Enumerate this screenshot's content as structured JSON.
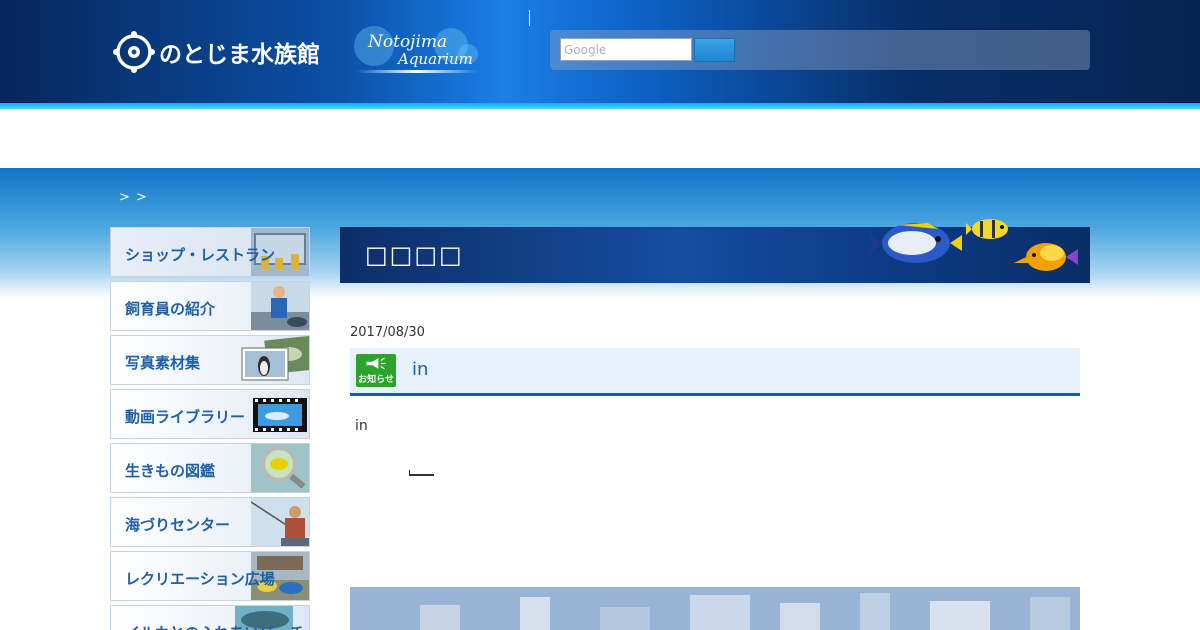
{
  "header": {
    "logo_jp": "のとじま水族館",
    "logo_en_line1": "Notojima",
    "logo_en_line2": "Aquarium"
  },
  "search": {
    "placeholder": "Google"
  },
  "breadcrumb": "> >",
  "sidebar": {
    "items": [
      {
        "label": "ショップ・レストラン"
      },
      {
        "label": "飼育員の紹介"
      },
      {
        "label": "写真素材集"
      },
      {
        "label": "動画ライブラリー"
      },
      {
        "label": "生きもの図鑑"
      },
      {
        "label": "海づりセンター"
      },
      {
        "label": "レクリエーション広場"
      },
      {
        "label": "イルカとのふれあいビーチ"
      }
    ]
  },
  "main": {
    "title": "□□□□",
    "post": {
      "date": "2017/08/30",
      "category_icon_label": "お知らせ",
      "title": "in",
      "body": "in"
    }
  },
  "colors": {
    "header_dark": "#06265a",
    "header_accent": "#1a7fe6",
    "title_bar": "#154da0",
    "sidebar_text": "#1f5fa6",
    "news_icon": "#2aa52a"
  }
}
